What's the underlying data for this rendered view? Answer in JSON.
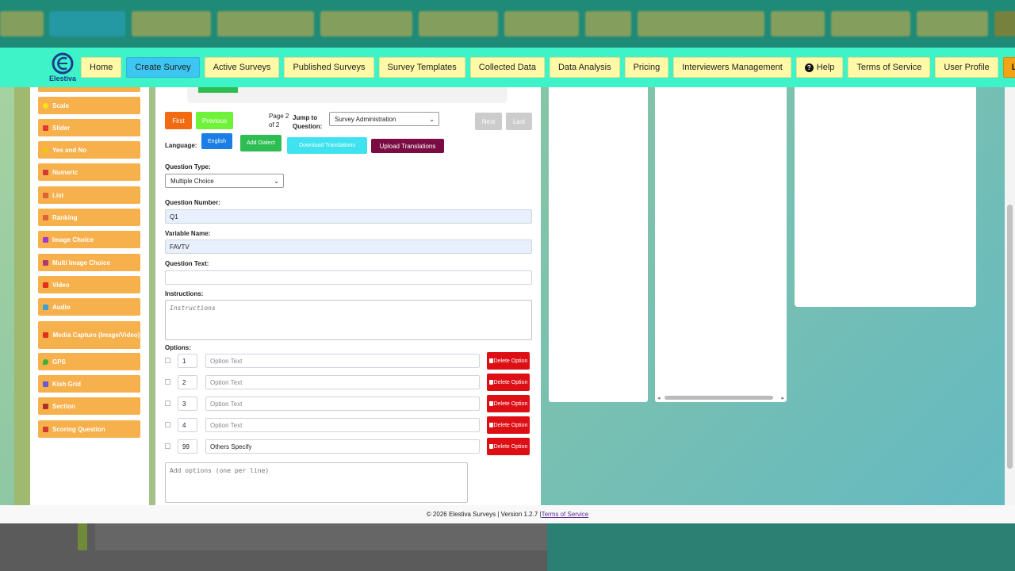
{
  "app": {
    "brand": "Elestiva"
  },
  "nav": {
    "items": [
      {
        "label": "Home"
      },
      {
        "label": "Create Survey"
      },
      {
        "label": "Active Surveys"
      },
      {
        "label": "Published Surveys"
      },
      {
        "label": "Survey Templates"
      },
      {
        "label": "Collected Data"
      },
      {
        "label": "Data Analysis"
      },
      {
        "label": "Pricing"
      },
      {
        "label": "Interviewers Management"
      },
      {
        "label": "Help"
      },
      {
        "label": "Terms of Service"
      },
      {
        "label": "User Profile"
      },
      {
        "label": "Logout"
      }
    ],
    "active": "Create Survey"
  },
  "sidebar": {
    "items": [
      {
        "label": "Scale",
        "icon": "scale-icon"
      },
      {
        "label": "Slider",
        "icon": "slider-icon"
      },
      {
        "label": "Yes and No",
        "icon": "thumbs-up-icon"
      },
      {
        "label": "Numeric",
        "icon": "numeric-icon"
      },
      {
        "label": "List",
        "icon": "list-icon"
      },
      {
        "label": "Ranking",
        "icon": "ranking-icon"
      },
      {
        "label": "Image Choice",
        "icon": "image-icon"
      },
      {
        "label": "Multi Image Choice",
        "icon": "images-icon"
      },
      {
        "label": "Video",
        "icon": "video-icon"
      },
      {
        "label": "Audio",
        "icon": "audio-icon"
      },
      {
        "label": "Media Capture (Image/Video)",
        "icon": "camera-icon"
      },
      {
        "label": "GPS",
        "icon": "map-pin-icon"
      },
      {
        "label": "Kish Grid",
        "icon": "users-icon"
      },
      {
        "label": "Section",
        "icon": "layers-icon"
      },
      {
        "label": "Scoring Question",
        "icon": "scoring-icon"
      }
    ]
  },
  "pager": {
    "first": "First",
    "previous": "Previous",
    "page_line1": "Page 2",
    "page_line2": "of 2",
    "jump_line1": "Jump to",
    "jump_line2": "Question:",
    "jump_selected": "Survey Administration",
    "next": "Next",
    "last": "Last"
  },
  "language": {
    "label": "Language:",
    "current": "English",
    "add_dialect": "Add Dialect",
    "download": "Download Translations",
    "upload": "Upload Translations"
  },
  "question": {
    "type_label": "Question Type:",
    "type_value": "Multiple Choice",
    "number_label": "Question Number:",
    "number_value": "Q1",
    "variable_label": "Variable Name:",
    "variable_value": "FAVTV",
    "text_label": "Question Text:",
    "text_value": "",
    "instructions_label": "Instructions:",
    "instructions_placeholder": "Instructions",
    "options_label": "Options:",
    "options": [
      {
        "code": "1",
        "text": "",
        "placeholder": "Option Text"
      },
      {
        "code": "2",
        "text": "",
        "placeholder": "Option Text"
      },
      {
        "code": "3",
        "text": "",
        "placeholder": "Option Text"
      },
      {
        "code": "4",
        "text": "",
        "placeholder": "Option Text"
      },
      {
        "code": "99",
        "text": "Others Specify",
        "placeholder": "Option Text"
      }
    ],
    "delete_option_label": "Delete Option",
    "bulk_placeholder": "Add options (one per line)"
  },
  "footer": {
    "text": "© 2026 Elestiva Surveys | Version 1.2.7 |",
    "terms_link": "Terms of Service"
  },
  "colors": {
    "nav_bg": "#3ff3c8",
    "nav_button": "#fff9a8",
    "nav_active": "#3ec6f2",
    "logout": "#f5a316",
    "sidebar_item": "#f6b04c",
    "first_btn": "#f26a12",
    "previous_btn": "#6ff23a",
    "english_btn": "#1a7ee6",
    "add_dialect_btn": "#2dbd53",
    "download_btn": "#3fe3f0",
    "upload_btn": "#7a0c43",
    "delete_btn": "#dd0f15"
  }
}
